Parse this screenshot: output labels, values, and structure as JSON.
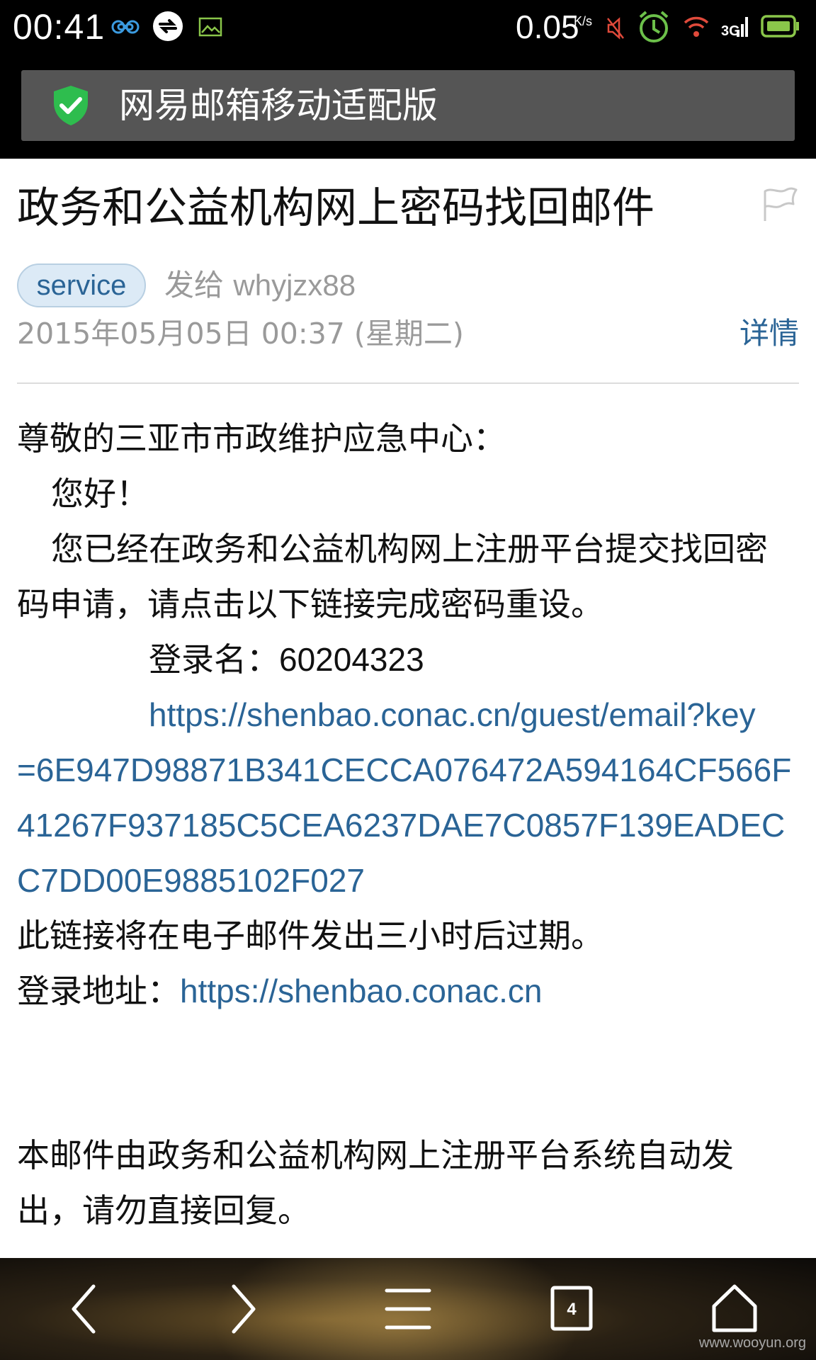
{
  "status_bar": {
    "time": "00:41",
    "net_speed": "0.05",
    "net_speed_unit": "K/s",
    "icons": [
      "infinity-icon",
      "sync-icon",
      "image-icon",
      "mute-icon",
      "alarm-icon",
      "wifi-icon",
      "signal-icon",
      "battery-icon"
    ]
  },
  "title_bar": {
    "title": "网易邮箱移动适配版",
    "icon": "shield-check-icon"
  },
  "email": {
    "subject": "政务和公益机构网上密码找回邮件",
    "sender_tag": "service",
    "to_label": "发给",
    "recipient": "whyjzx88",
    "date": "2015年05月05日 00:37 (星期二)",
    "details_link": "详情",
    "body": {
      "greeting": "尊敬的三亚市市政维护应急中心：",
      "hello": "您好！",
      "para_line1": "您已经在政务和公益机构网上注册平台提交找回密",
      "para_line2": "码申请，请点击以下链接完成密码重设。",
      "login_name_label": "登录名：",
      "login_name": "60204323",
      "reset_link_line1": "https://shenbao.conac.cn/guest/email?key",
      "reset_link_rest": "=6E947D98871B341CECCA076472A594164CF566F41267F937185C5CEA6237DAE7C0857F139EADECC7DD00E9885102F027",
      "expiry_note": "此链接将在电子邮件发出三小时后过期。",
      "login_address_label": "登录地址：",
      "login_address": "https://shenbao.conac.cn",
      "footer_line1": "本邮件由政务和公益机构网上注册平台系统自动发",
      "footer_line2": "出，请勿直接回复。"
    }
  },
  "nav_bar": {
    "tab_count": "4",
    "watermark": "www.wooyun.org",
    "buttons": [
      "back-icon",
      "forward-icon",
      "menu-icon",
      "tabs-icon",
      "home-icon"
    ]
  },
  "colors": {
    "link": "#2a6496",
    "title_bar_bg": "#555555",
    "status_bar_bg": "#000000",
    "tag_bg": "#dceaf6"
  }
}
